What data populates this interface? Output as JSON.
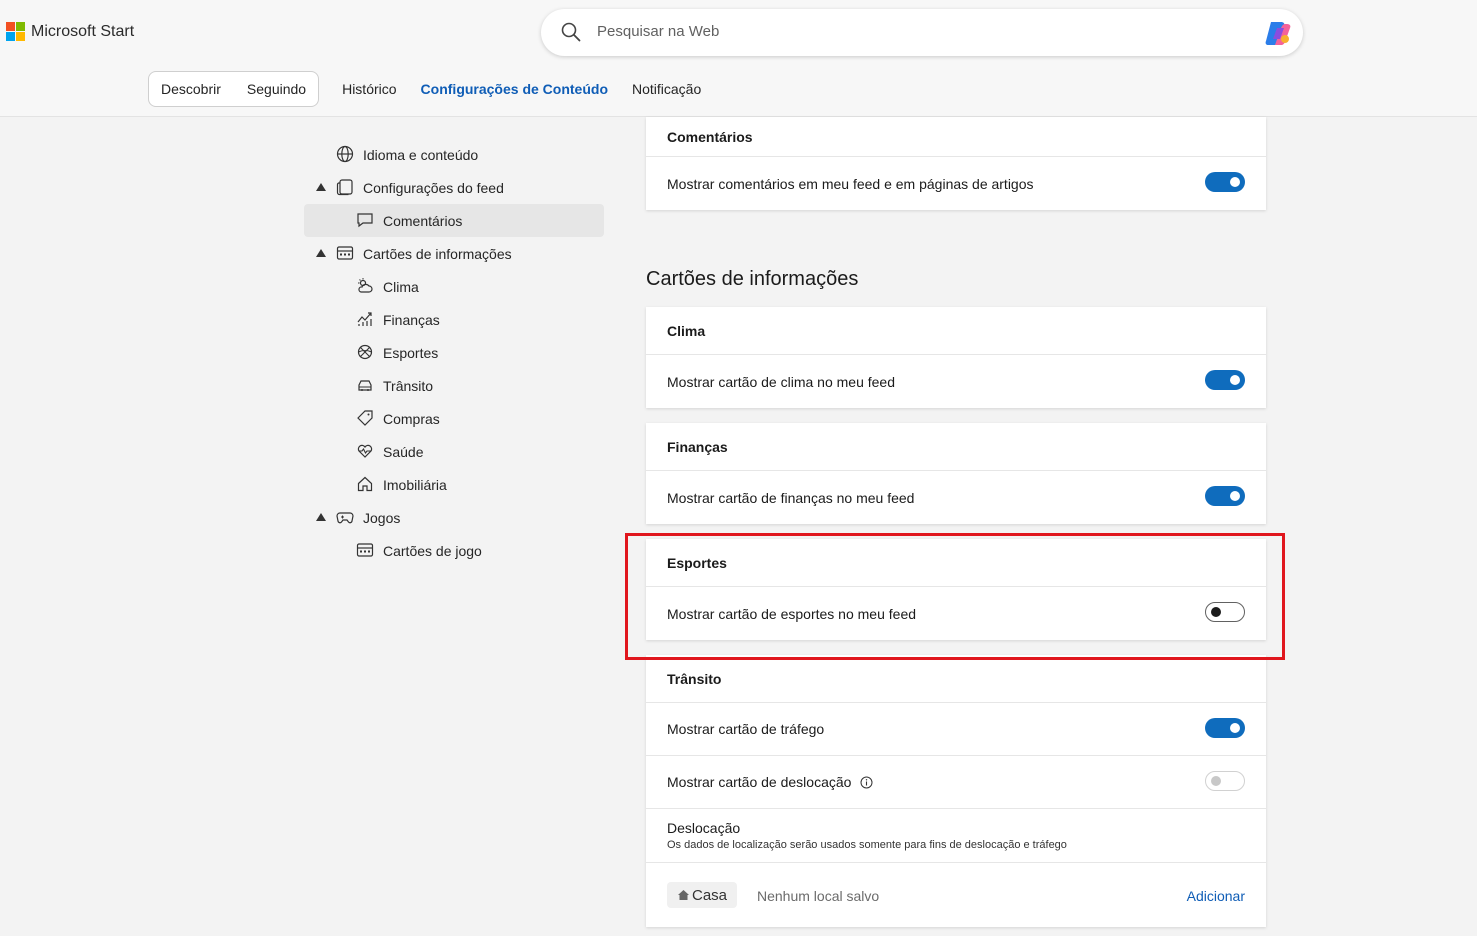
{
  "brand": {
    "name": "Microsoft Start",
    "colors": [
      "#f25022",
      "#7fba00",
      "#00a4ef",
      "#ffb900"
    ]
  },
  "search": {
    "placeholder": "Pesquisar na Web",
    "icon": "search-icon",
    "assistant_icon": "copilot-icon"
  },
  "nav": {
    "pill": [
      "Descobrir",
      "Seguindo"
    ],
    "links": [
      "Histórico",
      "Configurações de Conteúdo",
      "Notificação"
    ],
    "active": "Configurações de Conteúdo"
  },
  "sidebar": {
    "items": [
      {
        "label": "Idioma e conteúdo",
        "icon": "globe-icon",
        "level": 1
      },
      {
        "label": "Configurações do feed",
        "icon": "feed-icon",
        "level": 1,
        "expanded": true
      },
      {
        "label": "Comentários",
        "icon": "comment-icon",
        "level": 2,
        "selected": true
      },
      {
        "label": "Cartões de informações",
        "icon": "cards-icon",
        "level": 1,
        "expanded": true
      },
      {
        "label": "Clima",
        "icon": "weather-icon",
        "level": 2
      },
      {
        "label": "Finanças",
        "icon": "finance-icon",
        "level": 2
      },
      {
        "label": "Esportes",
        "icon": "sports-icon",
        "level": 2
      },
      {
        "label": "Trânsito",
        "icon": "car-icon",
        "level": 2
      },
      {
        "label": "Compras",
        "icon": "tag-icon",
        "level": 2
      },
      {
        "label": "Saúde",
        "icon": "health-icon",
        "level": 2
      },
      {
        "label": "Imobiliária",
        "icon": "home-icon",
        "level": 2
      },
      {
        "label": "Jogos",
        "icon": "gamepad-icon",
        "level": 1,
        "expanded": true
      },
      {
        "label": "Cartões de jogo",
        "icon": "cards-icon",
        "level": 2
      }
    ]
  },
  "main": {
    "comments": {
      "title": "Comentários",
      "row": "Mostrar comentários em meu feed e em páginas de artigos",
      "on": true
    },
    "section_title": "Cartões de informações",
    "clima": {
      "title": "Clima",
      "row": "Mostrar cartão de clima no meu feed",
      "on": true
    },
    "financas": {
      "title": "Finanças",
      "row": "Mostrar cartão de finanças no meu feed",
      "on": true
    },
    "esportes": {
      "title": "Esportes",
      "row": "Mostrar cartão de esportes no meu feed",
      "on": false
    },
    "transito": {
      "title": "Trânsito",
      "row1": "Mostrar cartão de tráfego",
      "row1_on": true,
      "row2": "Mostrar cartão de deslocação",
      "row2_on": false,
      "desloc_title": "Deslocação",
      "desloc_sub": "Os dados de localização serão usados somente para fins de deslocação e tráfego",
      "casa_label": "Casa",
      "casa_empty": "Nenhum local salvo",
      "casa_add": "Adicionar"
    }
  },
  "accent": "#0f6cbd",
  "highlight_color": "#e0161d"
}
